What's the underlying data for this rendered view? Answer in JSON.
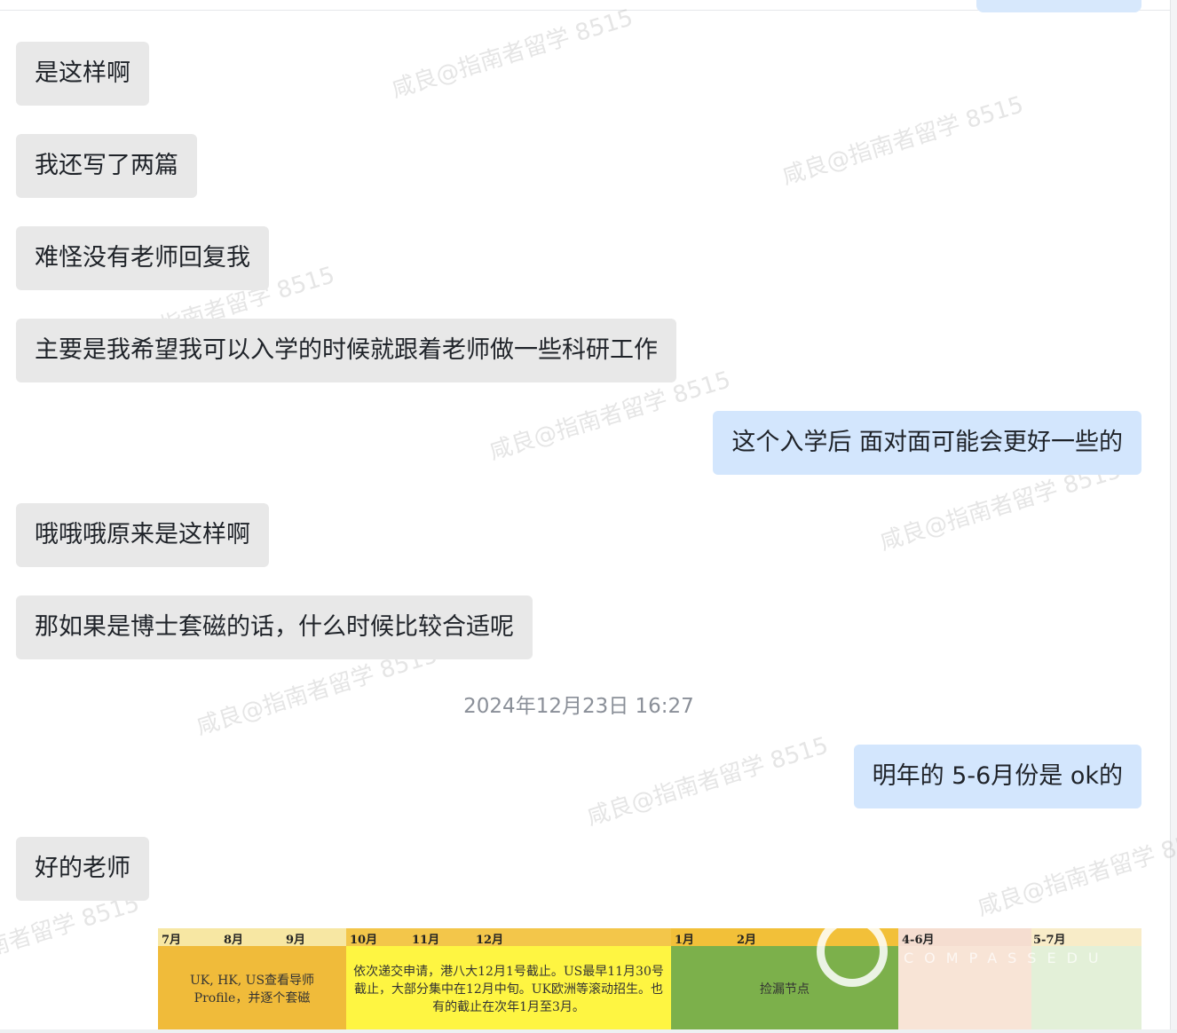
{
  "messages": [
    {
      "side": "left",
      "text": "是这样啊"
    },
    {
      "side": "left",
      "text": "我还写了两篇"
    },
    {
      "side": "left",
      "text": "难怪没有老师回复我"
    },
    {
      "side": "left",
      "text": "主要是我希望我可以入学的时候就跟着老师做一些科研工作"
    },
    {
      "side": "right",
      "text": "这个入学后 面对面可能会更好一些的"
    },
    {
      "side": "left",
      "text": "哦哦哦原来是这样啊"
    },
    {
      "side": "left",
      "text": "那如果是博士套磁的话，什么时候比较合适呢"
    },
    {
      "side": "right",
      "text": "明年的 5-6月份是 ok的"
    },
    {
      "side": "left",
      "text": "好的老师"
    }
  ],
  "timestamp": "2024年12月23日 16:27",
  "watermark": "咸良@指南者留学 8515",
  "timeline": {
    "months": [
      "7月",
      "8月",
      "9月",
      "10月",
      "11月",
      "12月",
      "1月",
      "2月",
      "4-6月",
      "5-7月"
    ],
    "segments": [
      "UK, HK, US查看导师Profile，并逐个套磁",
      "依次递交申请，港八大12月1号截止。US最早11月30号截止，大部分集中在12月中旬。UK欧洲等滚动招生。也有的截止在次年1月至3月。",
      "捡漏节点"
    ],
    "logo_text": "COMPASSEDU"
  }
}
